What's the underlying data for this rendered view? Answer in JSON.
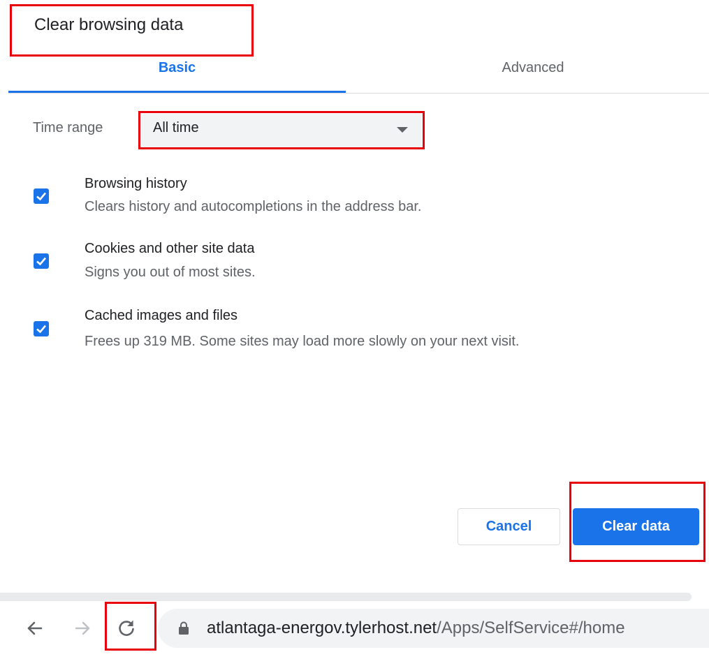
{
  "dialog": {
    "title": "Clear browsing data",
    "tabs": [
      {
        "label": "Basic",
        "active": true
      },
      {
        "label": "Advanced",
        "active": false
      }
    ],
    "time_range": {
      "label": "Time range",
      "value": "All time"
    },
    "options": [
      {
        "title": "Browsing history",
        "description": "Clears history and autocompletions in the address bar.",
        "checked": true
      },
      {
        "title": "Cookies and other site data",
        "description": "Signs you out of most sites.",
        "checked": true
      },
      {
        "title": "Cached images and files",
        "description": "Frees up 319 MB. Some sites may load more slowly on your next visit.",
        "checked": true
      }
    ],
    "buttons": {
      "cancel": "Cancel",
      "clear": "Clear data"
    }
  },
  "browser": {
    "url_host": "atlantaga-energov.tylerhost.net",
    "url_path": "/Apps/SelfService#/home",
    "icons": [
      "back-arrow-icon",
      "forward-arrow-icon",
      "reload-icon",
      "lock-icon"
    ]
  },
  "colors": {
    "accent": "#1a73e8",
    "highlight_box": "#e8000b",
    "secondary_text": "#5f6368"
  }
}
